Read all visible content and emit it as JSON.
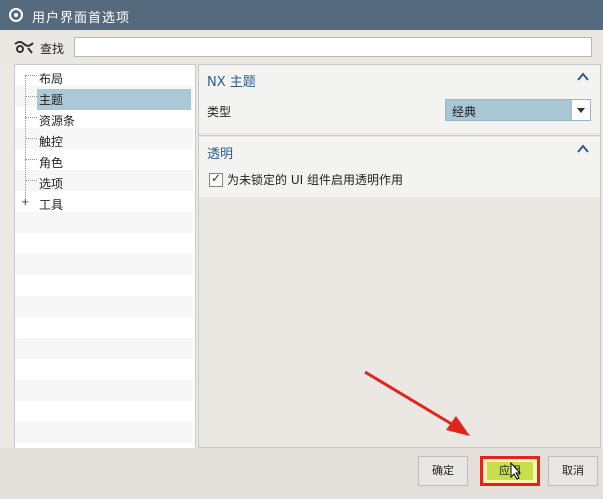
{
  "window": {
    "title": "用户界面首选项"
  },
  "search": {
    "label": "查找",
    "value": ""
  },
  "tree": {
    "items": [
      {
        "label": "布局",
        "selected": false,
        "expandable": false
      },
      {
        "label": "主题",
        "selected": true,
        "expandable": false
      },
      {
        "label": "资源条",
        "selected": false,
        "expandable": false
      },
      {
        "label": "触控",
        "selected": false,
        "expandable": false
      },
      {
        "label": "角色",
        "selected": false,
        "expandable": false
      },
      {
        "label": "选项",
        "selected": false,
        "expandable": false
      },
      {
        "label": "工具",
        "selected": false,
        "expandable": true
      }
    ],
    "expander_symbol": "+"
  },
  "sections": {
    "theme": {
      "title": "NX 主题",
      "type_label": "类型",
      "type_value": "经典"
    },
    "transparency": {
      "title": "透明",
      "checkbox_label": "为未锁定的 UI 组件启用透明作用",
      "checked": true
    }
  },
  "buttons": {
    "ok": "确定",
    "apply": "应用",
    "cancel": "取消"
  },
  "colors": {
    "titlebar": "#566a7e",
    "selection": "#aac8d7",
    "section_title": "#2e5c87",
    "highlight_border": "#e1251b",
    "arrow": "#e1251b"
  },
  "icons": {
    "title": "gear-icon",
    "search": "search-icon",
    "collapse": "chevron-up-icon",
    "dropdown": "chevron-down-icon"
  }
}
